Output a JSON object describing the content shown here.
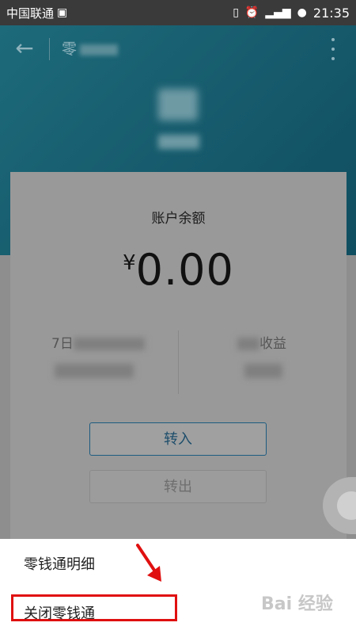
{
  "status_bar": {
    "carrier": "中国联通",
    "carrier_icon": "sim-card-icon",
    "time": "21:35",
    "icons": [
      "vibrate-icon",
      "alarm-icon",
      "signal-icon",
      "battery-icon"
    ]
  },
  "app_bar": {
    "back_icon": "←",
    "title": "零"
  },
  "card": {
    "balance_label": "账户余额",
    "currency_symbol": "¥",
    "balance_value": "0.00",
    "stat_left_label": "7日",
    "stat_right_label": "收益",
    "transfer_in_label": "转入",
    "transfer_out_label": "转出"
  },
  "bottom_sheet": {
    "items": [
      {
        "label": "零钱通明细"
      },
      {
        "label": "关闭零钱通"
      }
    ]
  },
  "watermark": "Bai 经验",
  "colors": {
    "header_teal": "#15596b",
    "highlight_red": "#e01010",
    "primary_blue": "#1d5c80"
  }
}
